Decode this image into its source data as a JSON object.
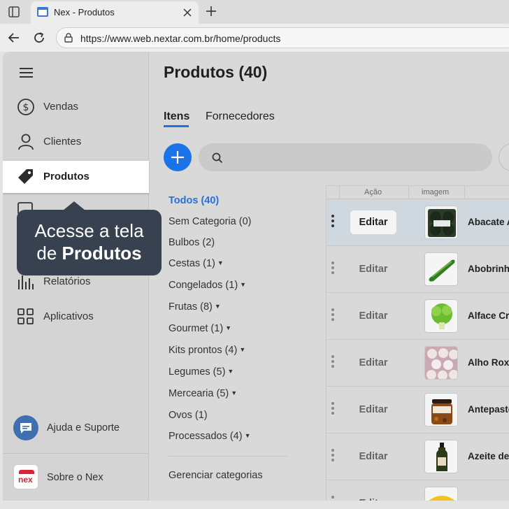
{
  "browser": {
    "tab_title": "Nex - Produtos",
    "url": "https://www.web.nextar.com.br/home/products"
  },
  "sidebar": {
    "items": [
      {
        "label": "Vendas",
        "icon": "dollar-circle-icon"
      },
      {
        "label": "Clientes",
        "icon": "user-icon"
      },
      {
        "label": "Produtos",
        "icon": "tag-icon"
      },
      {
        "label": "Relatórios",
        "icon": "bar-chart-icon"
      },
      {
        "label": "Aplicativos",
        "icon": "apps-grid-icon"
      }
    ],
    "help_label": "Ajuda e Suporte",
    "about_label": "Sobre o Nex",
    "logo_text": "nex"
  },
  "tooltip": {
    "line1": "Acesse a tela",
    "line2_prefix": "de",
    "line2_bold": "Produtos"
  },
  "main": {
    "title": "Produtos (40)",
    "tabs": [
      {
        "label": "Itens",
        "active": true
      },
      {
        "label": "Fornecedores",
        "active": false
      }
    ]
  },
  "categories": [
    {
      "label": "Todos (40)",
      "active": true,
      "expandable": false
    },
    {
      "label": "Sem Categoria (0)",
      "expandable": false
    },
    {
      "label": "Bulbos (2)",
      "expandable": false
    },
    {
      "label": "Cestas (1)",
      "expandable": true
    },
    {
      "label": "Congelados (1)",
      "expandable": true
    },
    {
      "label": "Frutas (8)",
      "expandable": true
    },
    {
      "label": "Gourmet (1)",
      "expandable": true
    },
    {
      "label": "Kits prontos (4)",
      "expandable": true
    },
    {
      "label": "Legumes (5)",
      "expandable": true
    },
    {
      "label": "Mercearia (5)",
      "expandable": true
    },
    {
      "label": "Ovos (1)",
      "expandable": false
    },
    {
      "label": "Processados (4)",
      "expandable": true
    }
  ],
  "manage_categories": "Gerenciar categorias",
  "table": {
    "headers": [
      "Ação",
      "imagem"
    ],
    "rows": [
      {
        "action": "Editar",
        "name": "Abacate A",
        "image": "abacate-pack",
        "selected": true
      },
      {
        "action": "Editar",
        "name": "Abobrinha",
        "image": "zucchini"
      },
      {
        "action": "Editar",
        "name": "Alface Cr",
        "image": "lettuce"
      },
      {
        "action": "Editar",
        "name": "Alho Roxo",
        "image": "garlic"
      },
      {
        "action": "Editar",
        "name": "Antepasto",
        "image": "jar"
      },
      {
        "action": "Editar",
        "name": "Azeite de",
        "image": "oil-bottle"
      },
      {
        "action": "Editar",
        "name": "",
        "image": "banana"
      }
    ]
  }
}
